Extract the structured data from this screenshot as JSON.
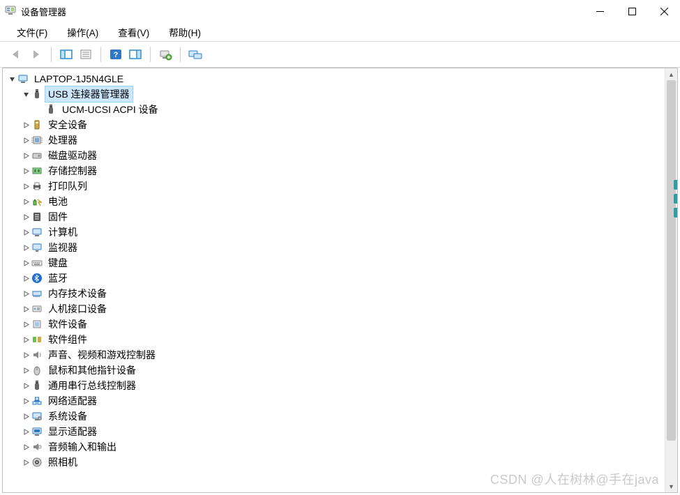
{
  "titlebar": {
    "title": "设备管理器"
  },
  "menubar": {
    "items": [
      {
        "label": "文件(F)"
      },
      {
        "label": "操作(A)"
      },
      {
        "label": "查看(V)"
      },
      {
        "label": "帮助(H)"
      }
    ]
  },
  "toolbar": {
    "back": "back-arrow",
    "forward": "forward-arrow",
    "show_hide_console": "console-tree",
    "properties": "properties",
    "help": "help",
    "scan": "scan-hardware",
    "add_legacy": "add-device",
    "remote": "remote-computer"
  },
  "tree": {
    "root": {
      "label": "LAPTOP-1J5N4GLE",
      "icon": "computer-icon",
      "expanded": true,
      "children": [
        {
          "label": "USB 连接器管理器",
          "icon": "usb-icon",
          "expanded": true,
          "selected": true,
          "children": [
            {
              "label": "UCM-UCSI ACPI 设备",
              "icon": "usb-icon",
              "leaf": true
            }
          ]
        },
        {
          "label": "安全设备",
          "icon": "security-icon"
        },
        {
          "label": "处理器",
          "icon": "cpu-icon"
        },
        {
          "label": "磁盘驱动器",
          "icon": "disk-icon"
        },
        {
          "label": "存储控制器",
          "icon": "storage-controller-icon"
        },
        {
          "label": "打印队列",
          "icon": "printer-icon"
        },
        {
          "label": "电池",
          "icon": "battery-icon"
        },
        {
          "label": "固件",
          "icon": "firmware-icon"
        },
        {
          "label": "计算机",
          "icon": "computer-icon"
        },
        {
          "label": "监视器",
          "icon": "monitor-icon"
        },
        {
          "label": "键盘",
          "icon": "keyboard-icon"
        },
        {
          "label": "蓝牙",
          "icon": "bluetooth-icon"
        },
        {
          "label": "内存技术设备",
          "icon": "memory-icon"
        },
        {
          "label": "人机接口设备",
          "icon": "hid-icon"
        },
        {
          "label": "软件设备",
          "icon": "software-device-icon"
        },
        {
          "label": "软件组件",
          "icon": "software-component-icon"
        },
        {
          "label": "声音、视频和游戏控制器",
          "icon": "sound-icon"
        },
        {
          "label": "鼠标和其他指针设备",
          "icon": "mouse-icon"
        },
        {
          "label": "通用串行总线控制器",
          "icon": "usb-icon"
        },
        {
          "label": "网络适配器",
          "icon": "network-icon"
        },
        {
          "label": "系统设备",
          "icon": "system-icon"
        },
        {
          "label": "显示适配器",
          "icon": "display-adapter-icon"
        },
        {
          "label": "音频输入和输出",
          "icon": "audio-io-icon"
        },
        {
          "label": "照相机",
          "icon": "camera-icon"
        }
      ]
    }
  },
  "watermark": "CSDN @人在树林@手在java"
}
